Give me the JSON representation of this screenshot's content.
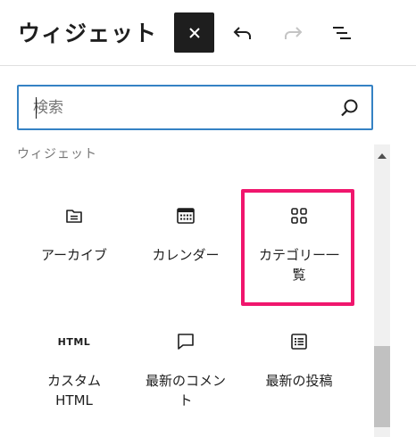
{
  "header": {
    "title": "ウィジェット"
  },
  "search": {
    "placeholder": "検索"
  },
  "section": {
    "label": "ウィジェット"
  },
  "blocks": [
    {
      "label": "アーカイブ",
      "icon": "archive-folder-icon"
    },
    {
      "label": "カレンダー",
      "icon": "calendar-icon"
    },
    {
      "label": "カテゴリー一覧",
      "icon": "categories-grid-icon"
    },
    {
      "label": "カスタム HTML",
      "icon_text": "HTML",
      "icon": "html-icon"
    },
    {
      "label": "最新のコメント",
      "icon": "comment-icon"
    },
    {
      "label": "最新の投稿",
      "icon": "post-list-icon"
    }
  ],
  "colors": {
    "highlight": "#f0166d",
    "focus": "#3582c4",
    "dark": "#1e1e1e"
  }
}
